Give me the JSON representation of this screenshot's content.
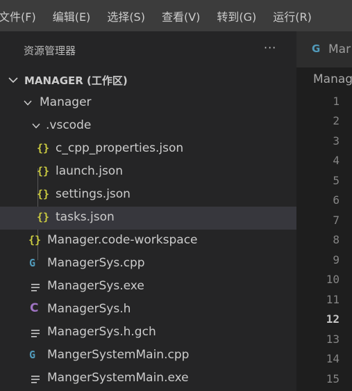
{
  "menubar": {
    "items": [
      "文件(F)",
      "编辑(E)",
      "选择(S)",
      "查看(V)",
      "转到(G)",
      "运行(R)"
    ]
  },
  "sidebar": {
    "title": "资源管理器",
    "more_label": "···",
    "section_title": "MANAGER (工作区)",
    "tree": [
      {
        "label": "Manager",
        "type": "folder",
        "icon": "chevron-down-icon"
      },
      {
        "label": ".vscode",
        "type": "folder",
        "icon": "chevron-down-icon"
      },
      {
        "label": "c_cpp_properties.json",
        "type": "file",
        "icon": "json-icon"
      },
      {
        "label": "launch.json",
        "type": "file",
        "icon": "json-icon"
      },
      {
        "label": "settings.json",
        "type": "file",
        "icon": "json-icon"
      },
      {
        "label": "tasks.json",
        "type": "file",
        "icon": "json-icon",
        "selected": true
      },
      {
        "label": "Manager.code-workspace",
        "type": "file",
        "icon": "json-icon"
      },
      {
        "label": "ManagerSys.cpp",
        "type": "file",
        "icon": "cpp-icon"
      },
      {
        "label": "ManagerSys.exe",
        "type": "file",
        "icon": "lines-icon"
      },
      {
        "label": "ManagerSys.h",
        "type": "file",
        "icon": "c-header-icon"
      },
      {
        "label": "ManagerSys.h.gch",
        "type": "file",
        "icon": "lines-icon"
      },
      {
        "label": "MangerSystemMain.cpp",
        "type": "file",
        "icon": "cpp-icon"
      },
      {
        "label": "MangerSystemMain.exe",
        "type": "file",
        "icon": "lines-icon"
      }
    ]
  },
  "editor": {
    "tab_label": "Mar",
    "breadcrumb": "Manag",
    "line_numbers": [
      "1",
      "2",
      "3",
      "4",
      "5",
      "6",
      "7",
      "8",
      "9",
      "10",
      "11",
      "12",
      "13",
      "14",
      "15"
    ],
    "active_line": "12"
  },
  "icons": {
    "json_braces": "{}",
    "cpp_glyph": "G",
    "h_glyph": "C"
  },
  "colors": {
    "json": "#cbcb41",
    "cpp": "#519aba",
    "header": "#a074c4",
    "selection": "#37373d"
  }
}
